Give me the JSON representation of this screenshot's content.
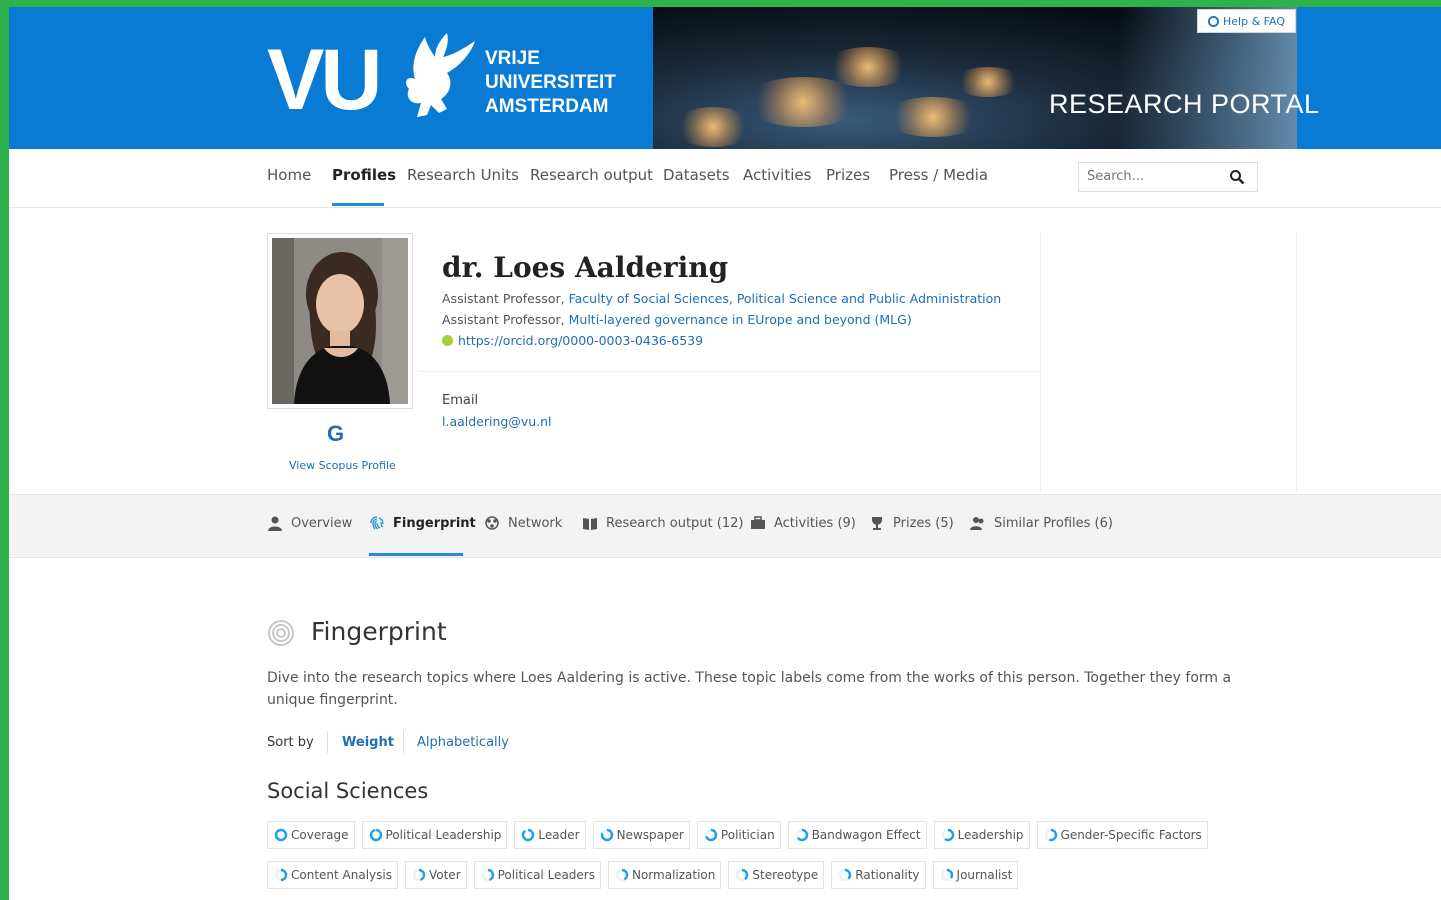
{
  "banner": {
    "logo_letters": "VU",
    "university_line1": "VRIJE",
    "university_line2": "UNIVERSITEIT",
    "university_line3": "AMSTERDAM",
    "portal_title": "RESEARCH PORTAL",
    "help_label": "Help & FAQ"
  },
  "nav": {
    "items": [
      "Home",
      "Profiles",
      "Research Units",
      "Research output",
      "Datasets",
      "Activities",
      "Prizes",
      "Press / Media"
    ],
    "active": "Profiles",
    "search_placeholder": "Search..."
  },
  "profile": {
    "name": "dr. Loes Aaldering",
    "role1_title": "Assistant Professor, ",
    "role1_link": "Faculty of Social Sciences, Political Science and Public Administration",
    "role2_title": "Assistant Professor, ",
    "role2_link": "Multi-layered governance in EUrope and beyond (MLG)",
    "orcid": "https://orcid.org/0000-0003-0436-6539",
    "email_label": "Email",
    "email": "l.aaldering@vu.nl",
    "scopus_letter": "G",
    "scopus_label": "View Scopus Profile"
  },
  "tabs": {
    "items": [
      "Overview",
      "Fingerprint",
      "Network",
      "Research output (12)",
      "Activities (9)",
      "Prizes (5)",
      "Similar Profiles (6)"
    ],
    "active": "Fingerprint"
  },
  "fingerprint": {
    "title": "Fingerprint",
    "description": "Dive into the research topics where Loes Aaldering is active. These topic labels come from the works of this person. Together they form a unique fingerprint.",
    "sort_label": "Sort by",
    "sort_weight": "Weight",
    "sort_alpha": "Alphabetically",
    "category": "Social Sciences",
    "chips_row1": [
      {
        "label": "Coverage",
        "weight": 1.0
      },
      {
        "label": "Political Leadership",
        "weight": 0.97
      },
      {
        "label": "Leader",
        "weight": 0.9
      },
      {
        "label": "Newspaper",
        "weight": 0.8
      },
      {
        "label": "Politician",
        "weight": 0.7
      },
      {
        "label": "Bandwagon Effect",
        "weight": 0.65
      },
      {
        "label": "Leadership",
        "weight": 0.6
      },
      {
        "label": "Gender-Specific Factors",
        "weight": 0.55
      }
    ],
    "chips_row2": [
      {
        "label": "Content Analysis",
        "weight": 0.5
      },
      {
        "label": "Voter",
        "weight": 0.45
      },
      {
        "label": "Political Leaders",
        "weight": 0.45
      },
      {
        "label": "Normalization",
        "weight": 0.42
      },
      {
        "label": "Stereotype",
        "weight": 0.4
      },
      {
        "label": "Rationality",
        "weight": 0.38
      },
      {
        "label": "Journalist",
        "weight": 0.35
      }
    ]
  },
  "colors": {
    "brand_blue": "#0a7bd4",
    "link_blue": "#1f6fb2",
    "accent_underline": "#1e8fd5",
    "chip_ring": "#1ea0e6",
    "outer_border": "#2db34a"
  }
}
